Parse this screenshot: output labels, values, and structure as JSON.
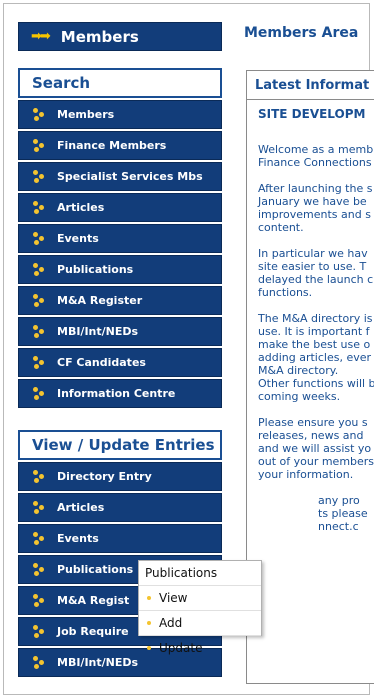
{
  "header": {
    "title": "Members",
    "arrow_icon": "double-arrow-icon"
  },
  "page_title": "Members Area",
  "search_panel": {
    "title": "Search",
    "items": [
      {
        "label": "Members"
      },
      {
        "label": "Finance Members"
      },
      {
        "label": "Specialist Services Mbs"
      },
      {
        "label": "Articles"
      },
      {
        "label": "Events"
      },
      {
        "label": "Publications"
      },
      {
        "label": "M&A Register"
      },
      {
        "label": "MBI/Int/NEDs"
      },
      {
        "label": "CF Candidates"
      },
      {
        "label": "Information Centre"
      }
    ]
  },
  "update_panel": {
    "title": "View / Update Entries",
    "items": [
      {
        "label": "Directory Entry"
      },
      {
        "label": "Articles"
      },
      {
        "label": "Events"
      },
      {
        "label": "Publications"
      },
      {
        "label": "M&A Regist"
      },
      {
        "label": "Job Require"
      },
      {
        "label": "MBI/Int/NEDs"
      }
    ]
  },
  "info": {
    "title": "Latest Informat",
    "heading": "SITE DEVELOPM",
    "paragraphs": [
      [
        "Welcome as a memb",
        "Finance Connections"
      ],
      [
        "After launching the s",
        "January we have be",
        "improvements and s",
        "content."
      ],
      [
        "In particular we hav",
        "site easier to use. T",
        "delayed the launch c",
        "functions."
      ],
      [
        "The M&A directory is",
        "use. It is important f",
        "make the best use o",
        "adding articles, ever",
        "M&A directory.",
        "Other functions will b",
        "coming weeks."
      ],
      [
        "Please ensure you s",
        "releases, news and",
        "and we will assist yo",
        "out of your members",
        "your information."
      ],
      [
        "any pro",
        "ts please",
        "nnect.c"
      ]
    ]
  },
  "popup": {
    "title": "Publications",
    "items": [
      {
        "label": "View"
      },
      {
        "label": "Add"
      },
      {
        "label": "Update"
      }
    ]
  },
  "colors": {
    "nav_bg": "#123d7a",
    "accent": "#f4c430",
    "text_blue": "#1a4f93"
  }
}
